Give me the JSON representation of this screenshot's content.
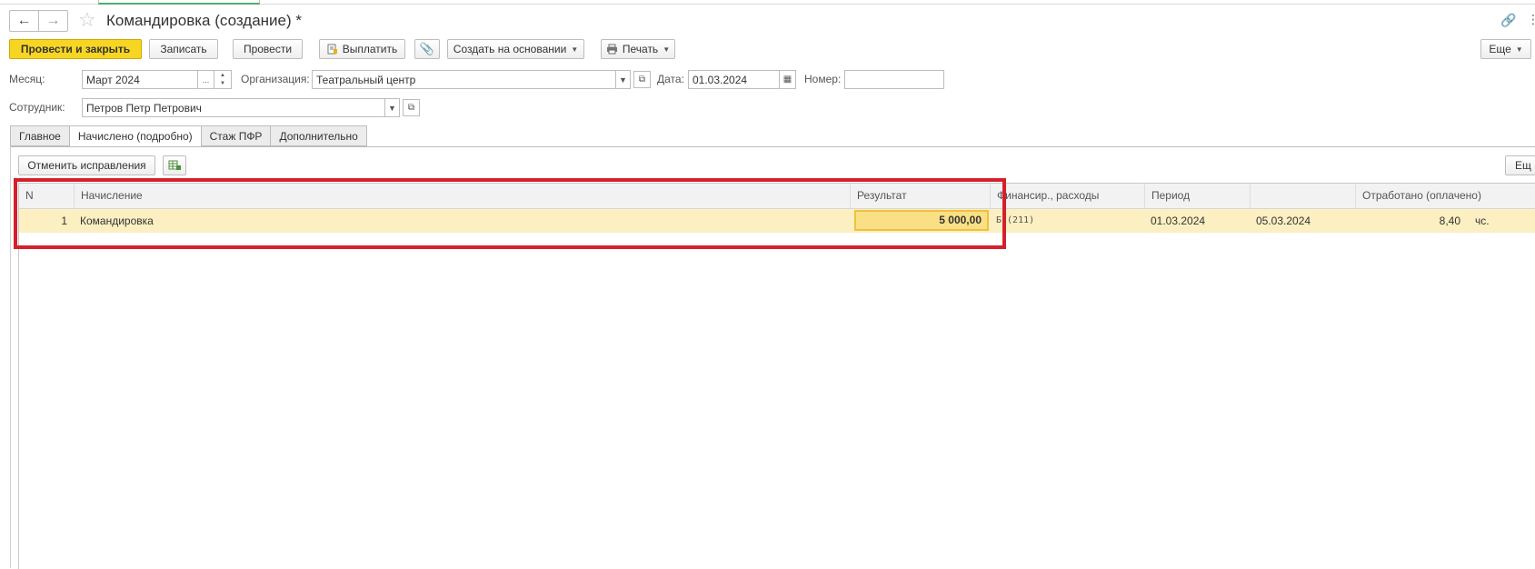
{
  "window": {
    "title": "Командировка (создание) *"
  },
  "toolbar": {
    "post_close": "Провести и закрыть",
    "save": "Записать",
    "post": "Провести",
    "pay": "Выплатить",
    "create_based": "Создать на основании",
    "print": "Печать",
    "more": "Еще"
  },
  "form": {
    "month_label": "Месяц:",
    "month_value": "Март 2024",
    "org_label": "Организация:",
    "org_value": "Театральный центр",
    "date_label": "Дата:",
    "date_value": "01.03.2024",
    "number_label": "Номер:",
    "number_value": "",
    "employee_label": "Сотрудник:",
    "employee_value": "Петров Петр Петрович"
  },
  "tabs": [
    "Главное",
    "Начислено (подробно)",
    "Стаж ПФР",
    "Дополнительно"
  ],
  "active_tab": "Начислено (подробно)",
  "subtoolbar": {
    "cancel_corrections": "Отменить исправления",
    "more": "Ещ"
  },
  "table": {
    "columns": {
      "n": "N",
      "accrual": "Начисление",
      "result": "Результат",
      "financing": "Финансир., расходы",
      "period": "Период",
      "worked": "Отработано (оплачено)"
    },
    "rows": [
      {
        "n": "1",
        "accrual": "Командировка",
        "result": "5 000,00",
        "financing": "Б (211)",
        "period_start": "01.03.2024",
        "period_end": "05.03.2024",
        "worked_value": "8,40",
        "worked_unit": "чс."
      }
    ]
  },
  "colors": {
    "primary_button": "#f7d623",
    "row_highlight": "#fcefc1",
    "selected_cell": "#f9df86",
    "annotation_frame": "#d4202c"
  }
}
